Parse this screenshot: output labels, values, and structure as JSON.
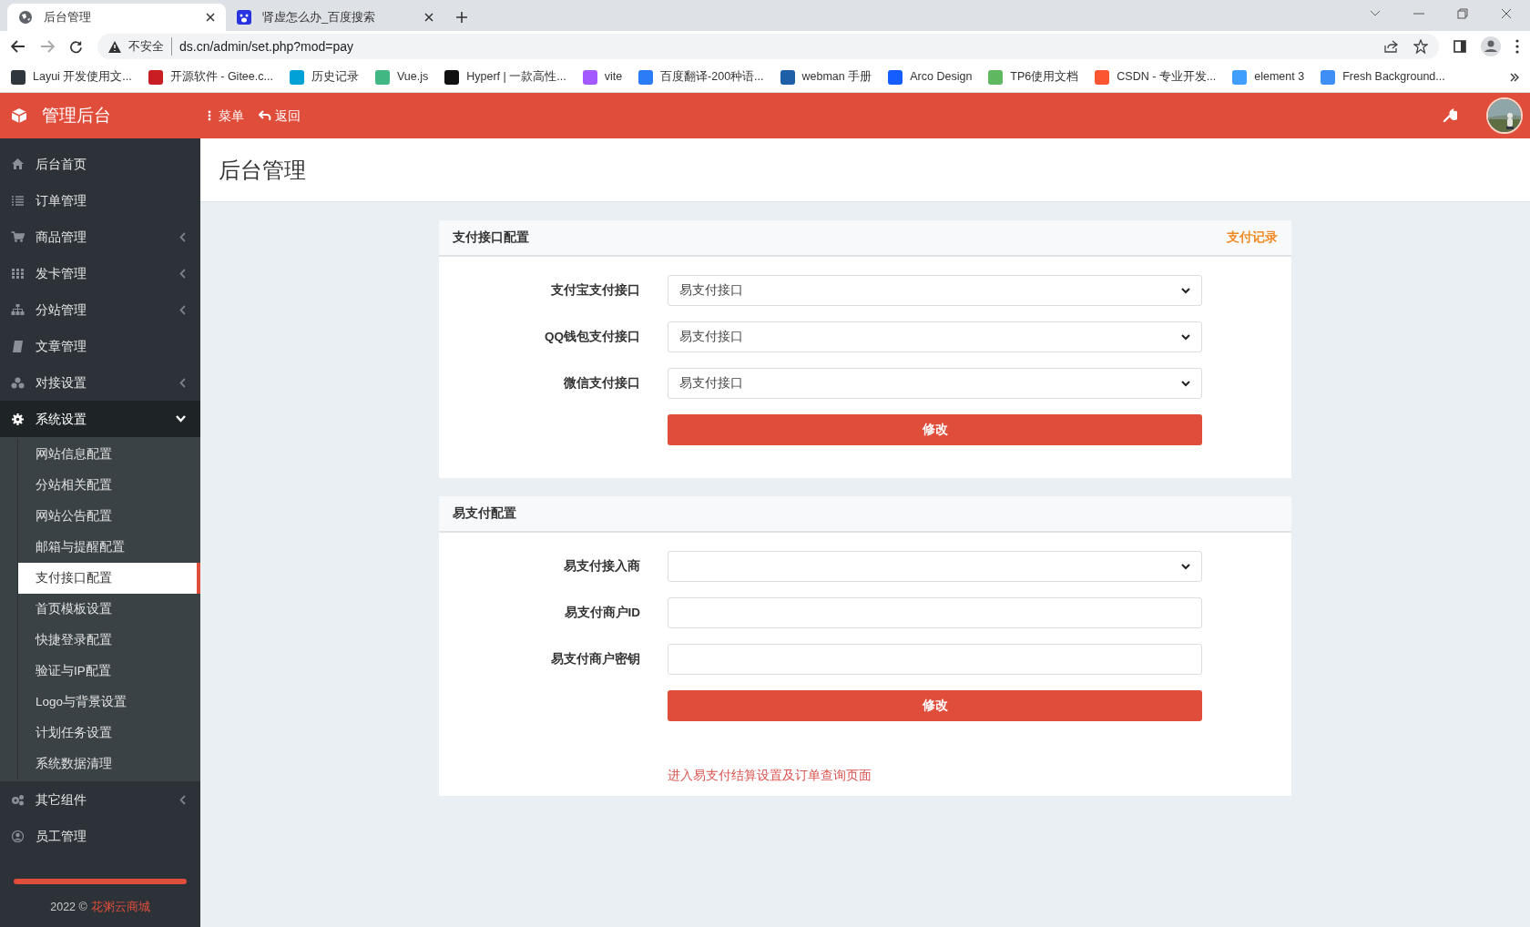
{
  "browser": {
    "tabs": [
      {
        "title": "后台管理",
        "selected": true
      },
      {
        "title": "肾虚怎么办_百度搜索",
        "selected": false
      }
    ],
    "security": "不安全",
    "url": "ds.cn/admin/set.php?mod=pay",
    "bookmarks": [
      {
        "label": "Layui 开发使用文...",
        "color": "#2f363c"
      },
      {
        "label": "开源软件 - Gitee.c...",
        "color": "#c71d23"
      },
      {
        "label": "历史记录",
        "color": "#00a1d6"
      },
      {
        "label": "Vue.js",
        "color": "#41b883"
      },
      {
        "label": "Hyperf | 一款高性...",
        "color": "#111111"
      },
      {
        "label": "vite",
        "color": "#a259ff"
      },
      {
        "label": "百度翻译-200种语...",
        "color": "#2b7cf6"
      },
      {
        "label": "webman 手册",
        "color": "#1f5fa8"
      },
      {
        "label": "Arco Design",
        "color": "#165dff"
      },
      {
        "label": "TP6使用文档",
        "color": "#5fb760"
      },
      {
        "label": "CSDN - 专业开发...",
        "color": "#fc5531"
      },
      {
        "label": "element 3",
        "color": "#409eff"
      },
      {
        "label": "Fresh Background...",
        "color": "#3f8ef5"
      }
    ]
  },
  "header": {
    "brand": "管理后台",
    "menu": "菜单",
    "back": "返回"
  },
  "sidebar": {
    "items": [
      {
        "label": "后台首页",
        "selected": false
      },
      {
        "label": "订单管理",
        "selected": false
      },
      {
        "label": "商品管理",
        "selected": false,
        "expanded": false
      },
      {
        "label": "发卡管理",
        "selected": false,
        "expanded": false
      },
      {
        "label": "分站管理",
        "selected": false,
        "expanded": false
      },
      {
        "label": "文章管理",
        "selected": false
      },
      {
        "label": "对接设置",
        "selected": false,
        "expanded": false
      },
      {
        "label": "系统设置",
        "selected": true,
        "expanded": true,
        "children": [
          {
            "label": "网站信息配置",
            "selected": false
          },
          {
            "label": "分站相关配置",
            "selected": false
          },
          {
            "label": "网站公告配置",
            "selected": false
          },
          {
            "label": "邮箱与提醒配置",
            "selected": false
          },
          {
            "label": "支付接口配置",
            "selected": true
          },
          {
            "label": "首页模板设置",
            "selected": false
          },
          {
            "label": "快捷登录配置",
            "selected": false
          },
          {
            "label": "验证与IP配置",
            "selected": false
          },
          {
            "label": "Logo与背景设置",
            "selected": false
          },
          {
            "label": "计划任务设置",
            "selected": false
          },
          {
            "label": "系统数据清理",
            "selected": false
          }
        ]
      },
      {
        "label": "其它组件",
        "selected": false,
        "expanded": false
      },
      {
        "label": "员工管理",
        "selected": false
      }
    ],
    "footer_year": "2022 ©",
    "footer_link": "花粥云商城"
  },
  "page_title": "后台管理",
  "panels": [
    {
      "title": "支付接口配置",
      "link": "支付记录",
      "fields": [
        {
          "label": "支付宝支付接口",
          "kind": "select",
          "value": "易支付接口"
        },
        {
          "label": "QQ钱包支付接口",
          "kind": "select",
          "value": "易支付接口"
        },
        {
          "label": "微信支付接口",
          "kind": "select",
          "value": "易支付接口"
        }
      ],
      "button": "修改"
    },
    {
      "title": "易支付配置",
      "fields": [
        {
          "label": "易支付接入商",
          "kind": "select"
        },
        {
          "label": "易支付商户ID",
          "kind": "text"
        },
        {
          "label": "易支付商户密钥",
          "kind": "text"
        }
      ],
      "button": "修改",
      "footer_link": "进入易支付结算设置及订单查询页面"
    }
  ]
}
